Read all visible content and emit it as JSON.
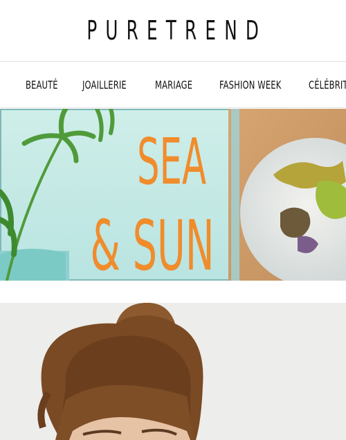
{
  "site": {
    "logo": "PURETREND"
  },
  "nav": {
    "items": [
      {
        "label": "Beauté"
      },
      {
        "label": "Joaillerie"
      },
      {
        "label": "Mariage"
      },
      {
        "label": "Fashion Week"
      },
      {
        "label": "Célébrit"
      }
    ]
  },
  "banner": {
    "line1": "SEA",
    "line2": "& SUN"
  },
  "colors": {
    "accent_orange": "#f08c2c",
    "nav_text": "#111111",
    "divider": "#e2e2e2"
  }
}
